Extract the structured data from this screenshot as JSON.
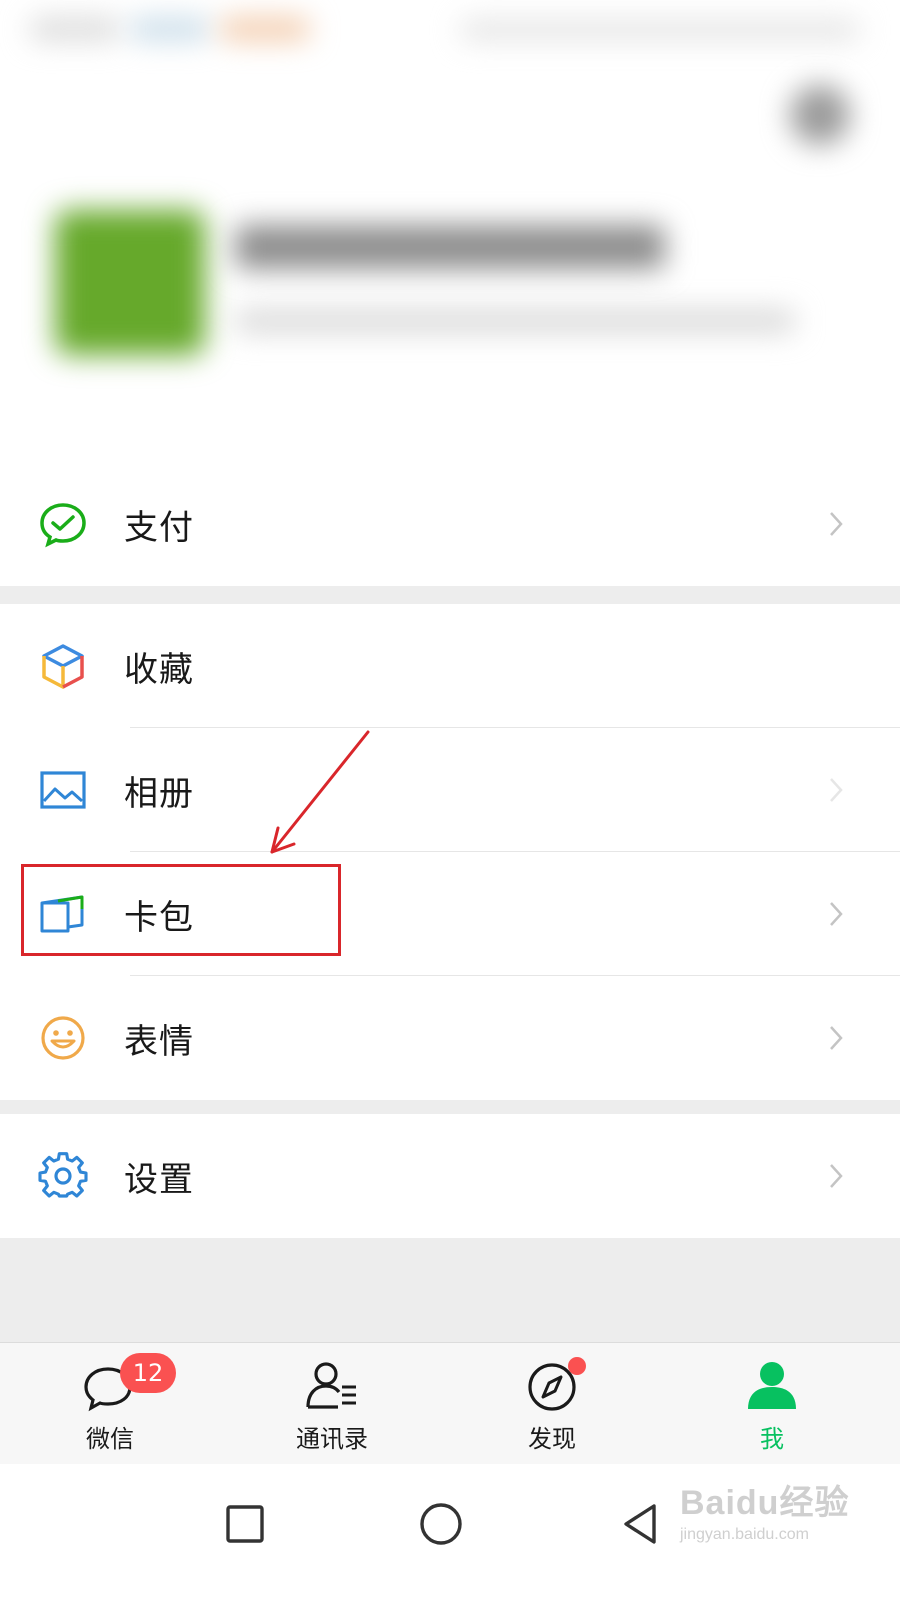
{
  "menu": {
    "group1": [
      {
        "label": "支付",
        "icon": "wechat-pay-icon"
      }
    ],
    "group2": [
      {
        "label": "收藏",
        "icon": "favorites-cube-icon"
      },
      {
        "label": "相册",
        "icon": "album-picture-icon"
      },
      {
        "label": "卡包",
        "icon": "card-wallet-icon"
      },
      {
        "label": "表情",
        "icon": "smiley-face-icon"
      }
    ],
    "group3": [
      {
        "label": "设置",
        "icon": "gear-icon"
      }
    ]
  },
  "tabbar": {
    "tabs": [
      {
        "label": "微信",
        "icon": "chat-bubble-icon",
        "badge": "12"
      },
      {
        "label": "通讯录",
        "icon": "contacts-icon"
      },
      {
        "label": "发现",
        "icon": "compass-icon",
        "dot": true
      },
      {
        "label": "我",
        "icon": "person-icon",
        "active": true
      }
    ]
  },
  "watermark": {
    "logo": "Baidu经验",
    "url": "jingyan.baidu.com"
  },
  "colors": {
    "accent_green": "#07c160",
    "badge_red": "#fa5151",
    "annotation_red": "#d9262b"
  }
}
